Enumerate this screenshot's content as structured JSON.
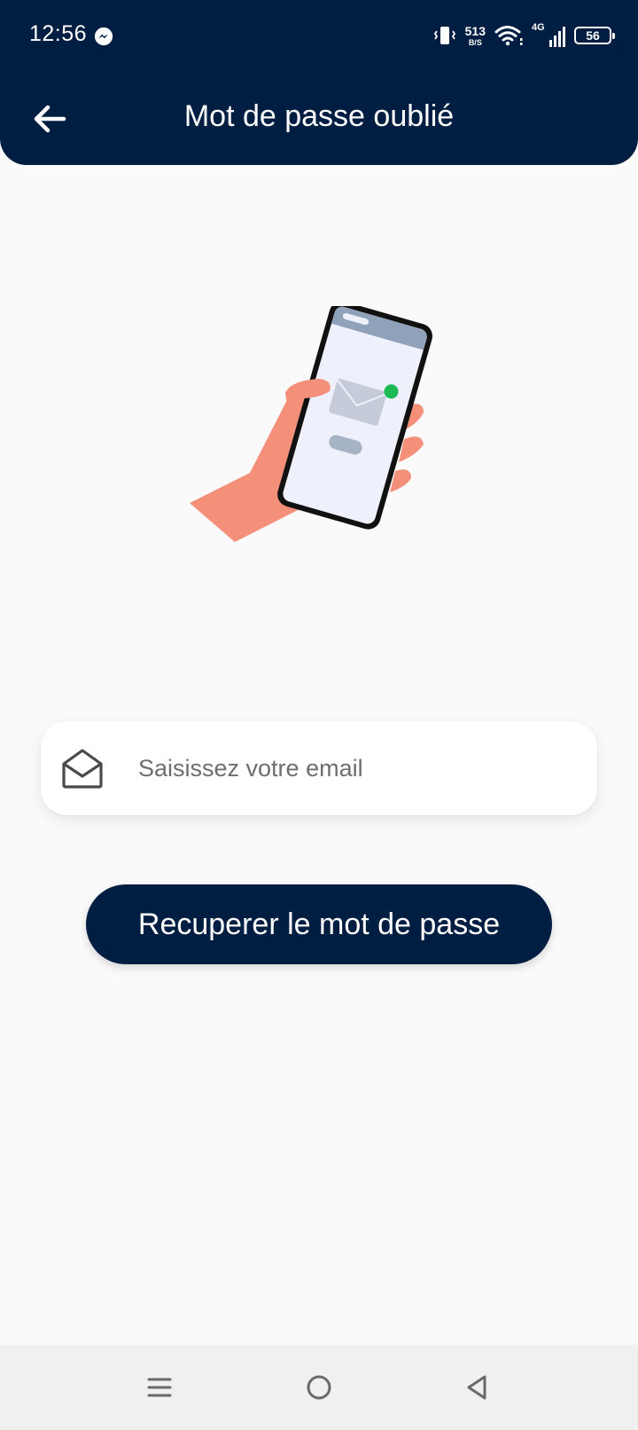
{
  "status_bar": {
    "time": "12:56",
    "netspeed_value": "513",
    "netspeed_unit": "B/S",
    "network_type": "4G",
    "battery_level": "56",
    "icons": [
      "messenger-icon",
      "vibrate-icon",
      "wifi-icon",
      "signal-icon",
      "battery-icon"
    ]
  },
  "header": {
    "title": "Mot de passe oublié",
    "back_icon": "arrow-left-icon"
  },
  "illustration": {
    "description_icon": "hand-holding-phone-with-email-icon"
  },
  "email_field": {
    "placeholder": "Saisissez votre email",
    "value": "",
    "icon": "open-envelope-icon"
  },
  "recover_button": {
    "label": "Recuperer le mot de passe"
  },
  "nav_bar": {
    "icons": [
      "menu-icon",
      "home-icon",
      "back-triangle-icon"
    ]
  },
  "colors": {
    "primary": "#001e42",
    "background": "#fafafa",
    "card": "#ffffff",
    "skin": "#f4907a",
    "accent_green": "#1db954"
  }
}
